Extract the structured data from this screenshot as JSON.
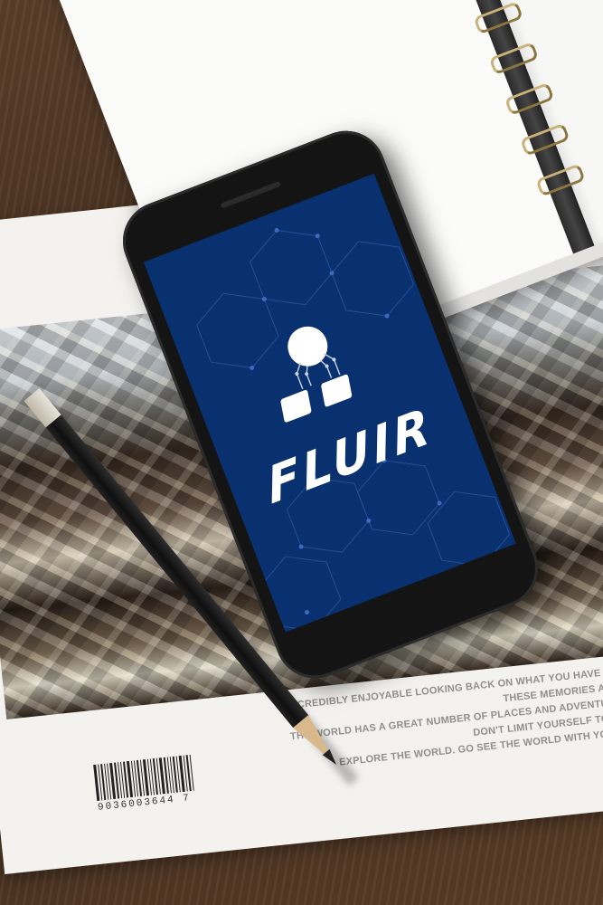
{
  "app": {
    "logo_text": "FLUIR",
    "screen_color": "#09306f",
    "logo_color": "#ffffff"
  },
  "magazine": {
    "text_lines": [
      "INCREDIBLY ENJOYABLE LOOKING BACK ON WHAT YOU HAVE DONE WHEN YOU TRAVEL",
      "THESE MEMORIES ARE PRECIOUS",
      "THE WORLD HAS A GREAT NUMBER OF PLACES AND ADVENTURES FOR YOU TO EXPLORE",
      "DON'T LIMIT YOURSELF TO YOUR LITTLE",
      "EXPLORE THE WORLD. GO SEE THE WORLD WITH YOUR OWN EYES"
    ],
    "barcode_number": "9036003644 7"
  },
  "icons": {
    "logo": "fluir-logo-icon",
    "barcode": "barcode-icon"
  }
}
